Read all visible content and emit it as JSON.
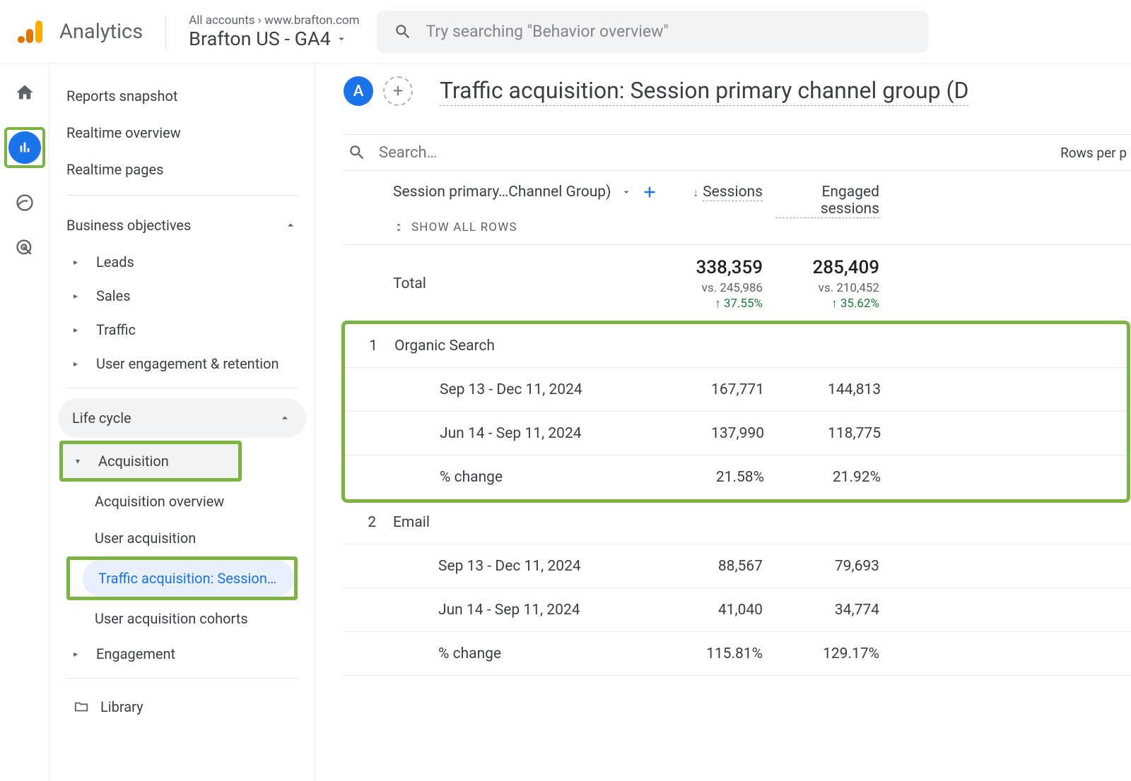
{
  "header": {
    "product": "Analytics",
    "breadcrumb1": "All accounts",
    "breadcrumb2": "www.brafton.com",
    "account_name": "Brafton US - GA4",
    "search_placeholder": "Try searching \"Behavior overview\""
  },
  "sidebar": {
    "snapshot": "Reports snapshot",
    "realtime_over": "Realtime overview",
    "realtime_pages": "Realtime pages",
    "section1": "Business objectives",
    "s1": {
      "leads": "Leads",
      "sales": "Sales",
      "traffic": "Traffic",
      "uer": "User engagement & retention"
    },
    "section2": "Life cycle",
    "acquisition": "Acquisition",
    "acq": {
      "over": "Acquisition overview",
      "user": "User acquisition",
      "traffic": "Traffic acquisition: Session…",
      "cohorts": "User acquisition cohorts"
    },
    "engagement": "Engagement",
    "library": "Library"
  },
  "main": {
    "bubble": "A",
    "title": "Traffic acquisition: Session primary channel group (D",
    "search_ph": "Search…",
    "rows_per": "Rows per p",
    "dim_name": "Session primary…Channel Group)",
    "show_all": "SHOW ALL ROWS",
    "col_sessions": "Sessions",
    "col_engaged": "Engaged sessions",
    "total_label": "Total",
    "totals": {
      "sessions": "338,359",
      "sessions_vs": "vs. 245,986",
      "sessions_pct": "↑ 37.55%",
      "engaged": "285,409",
      "engaged_vs": "vs. 210,452",
      "engaged_pct": "↑ 35.62%"
    },
    "rows": [
      {
        "idx": "1",
        "name": "Organic Search",
        "d1": {
          "label": "Sep 13 - Dec 11, 2024",
          "s": "167,771",
          "e": "144,813"
        },
        "d2": {
          "label": "Jun 14 - Sep 11, 2024",
          "s": "137,990",
          "e": "118,775"
        },
        "chg": {
          "label": "% change",
          "s": "21.58%",
          "e": "21.92%"
        }
      },
      {
        "idx": "2",
        "name": "Email",
        "d1": {
          "label": "Sep 13 - Dec 11, 2024",
          "s": "88,567",
          "e": "79,693"
        },
        "d2": {
          "label": "Jun 14 - Sep 11, 2024",
          "s": "41,040",
          "e": "34,774"
        },
        "chg": {
          "label": "% change",
          "s": "115.81%",
          "e": "129.17%"
        }
      }
    ]
  }
}
